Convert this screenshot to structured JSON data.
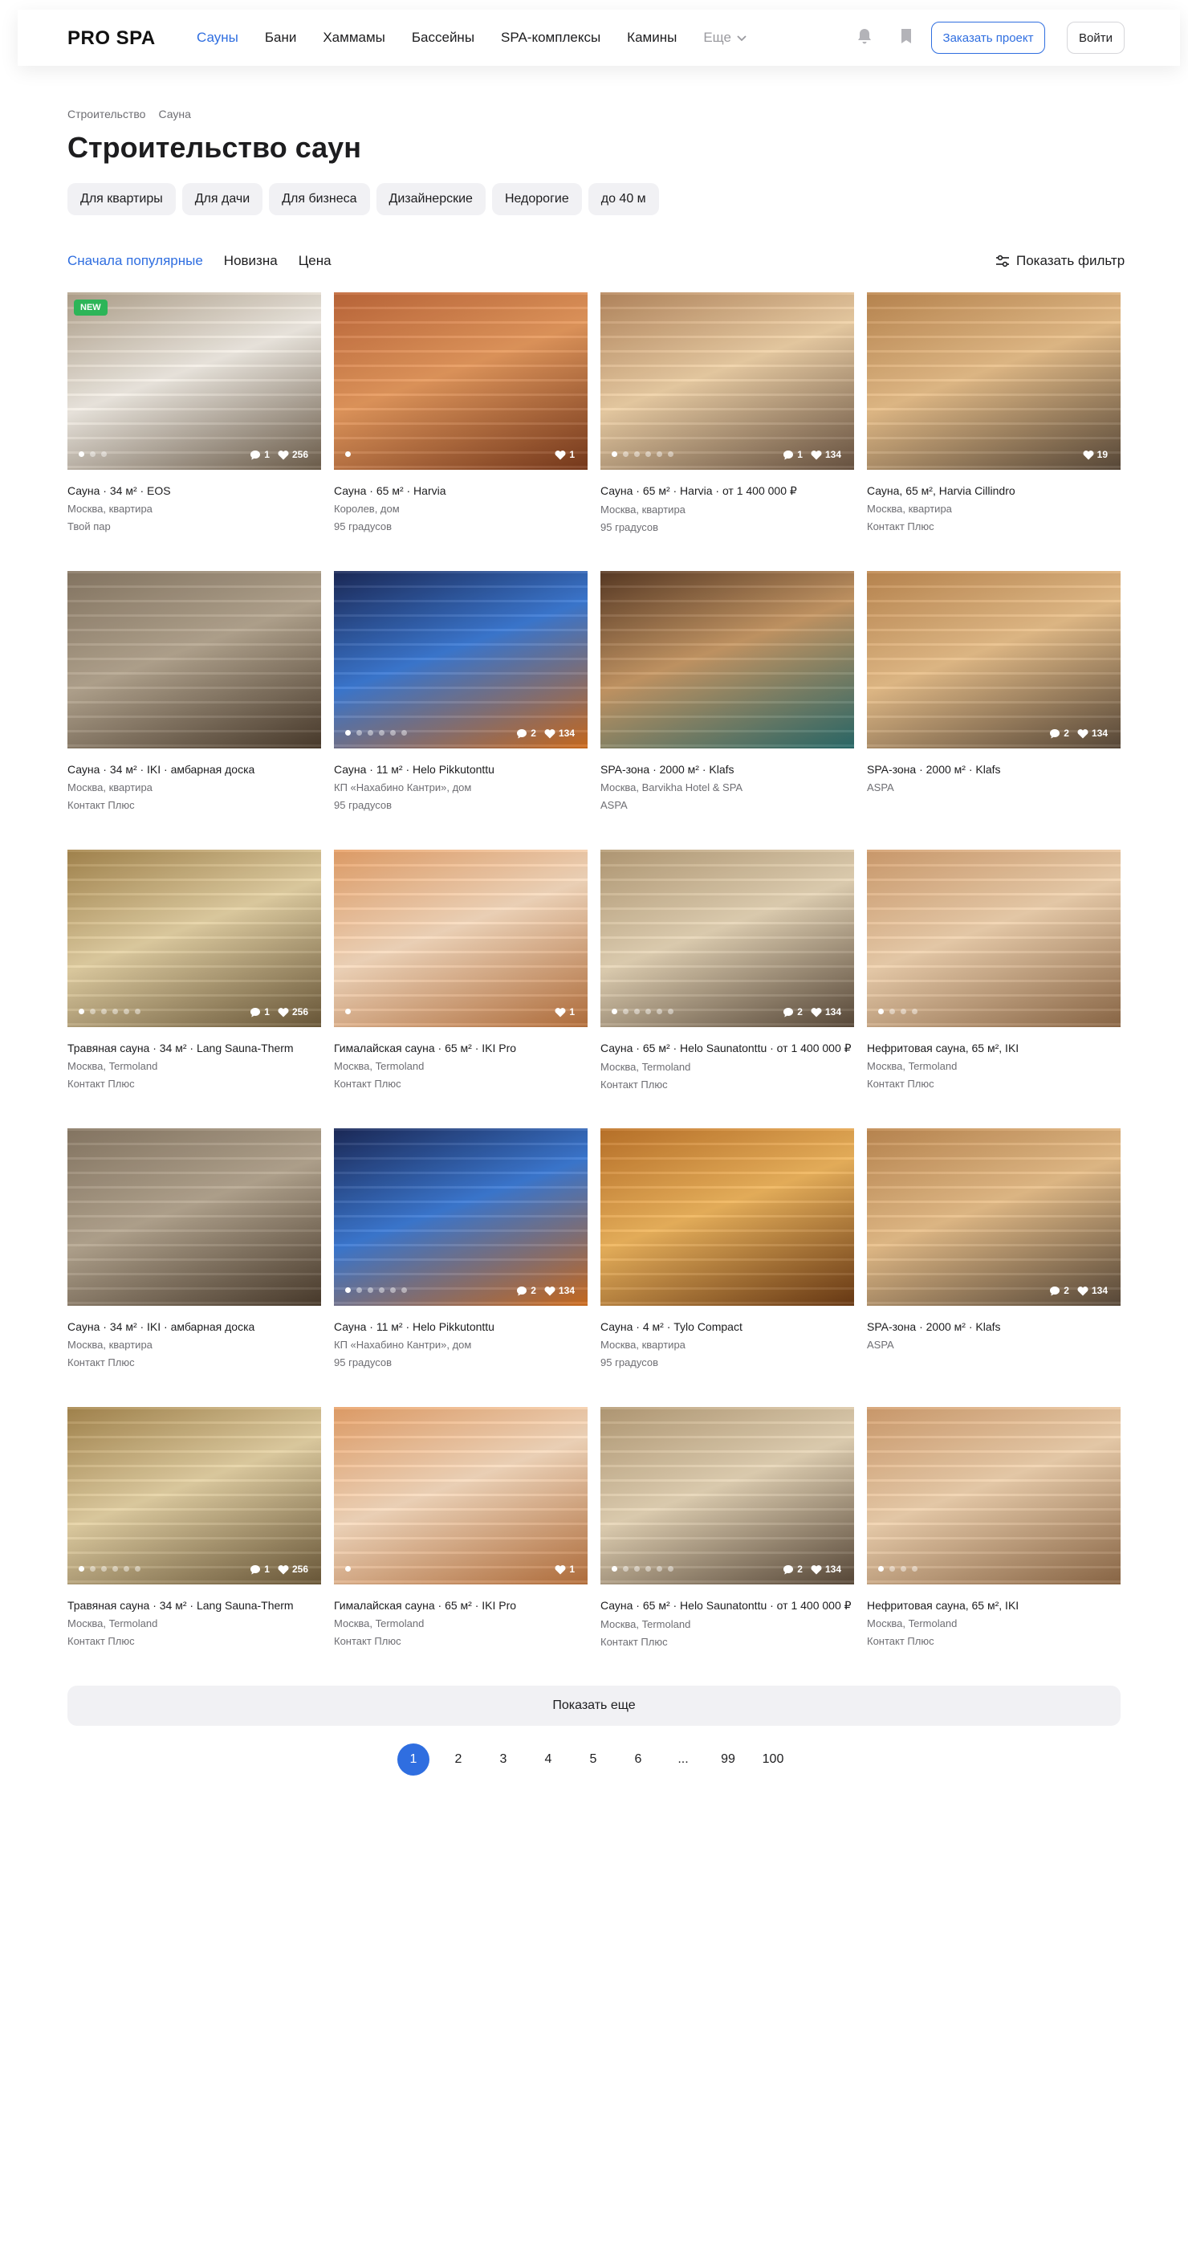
{
  "header": {
    "logo": "PRO SPA",
    "nav": [
      "Сауны",
      "Бани",
      "Хаммамы",
      "Бассейны",
      "SPA-комплексы",
      "Камины"
    ],
    "nav_active_index": 0,
    "more_label": "Еще",
    "order_button": "Заказать проект",
    "login_button": "Войти"
  },
  "breadcrumb": [
    "Строительство",
    "Сауна"
  ],
  "page_title": "Строительство саун",
  "chips": [
    "Для квартиры",
    "Для дачи",
    "Для бизнеса",
    "Дизайнерские",
    "Недорогие",
    "до 40 м"
  ],
  "sort": {
    "options": [
      "Сначала популярные",
      "Новизна",
      "Цена"
    ],
    "active_index": 0
  },
  "filter_label": "Показать фильтр",
  "colors": {
    "accent": "#2f6ee0",
    "new_badge": "#2db558"
  },
  "cards": [
    {
      "title": "Сауна · 34 м² · EOS",
      "location": "Москва, квартира",
      "company": "Твой пар",
      "badge": "NEW",
      "comments": "1",
      "likes": "256",
      "dots": 3,
      "palette": [
        "#b5a58f",
        "#f4efe7",
        "#6f5f4c"
      ]
    },
    {
      "title": "Сауна · 65 м² · Harvia",
      "location": "Королев, дом",
      "company": "95 градусов",
      "badge": "",
      "comments": "",
      "likes": "1",
      "dots": 1,
      "palette": [
        "#c2693b",
        "#e79a5e",
        "#7a3a1c"
      ]
    },
    {
      "title": "Сауна · 65 м² · Harvia · от 1 400 000 ₽",
      "location": "Москва, квартира",
      "company": "95 градусов",
      "badge": "",
      "comments": "1",
      "likes": "134",
      "dots": 6,
      "palette": [
        "#b98a60",
        "#f0d2a8",
        "#6a5442"
      ]
    },
    {
      "title": "Сауна, 65 м², Harvia Cillindro",
      "location": "Москва, квартира",
      "company": "Контакт Плюс",
      "badge": "",
      "comments": "",
      "likes": "19",
      "dots": 0,
      "palette": [
        "#c08a52",
        "#e9c08b",
        "#5a4a3a"
      ]
    },
    {
      "title": "Сауна · 34 м² · IKI · амбарная доска",
      "location": "Москва, квартира",
      "company": "Контакт Плюс",
      "badge": "",
      "comments": "",
      "likes": "",
      "dots": 0,
      "palette": [
        "#8a7a66",
        "#b7a892",
        "#4a3b2c"
      ]
    },
    {
      "title": "Сауна · 11 м² · Helo Pikkutonttu",
      "location": "КП «Нахабино Кантри», дом",
      "company": "95 градусов",
      "badge": "",
      "comments": "2",
      "likes": "134",
      "dots": 6,
      "palette": [
        "#1c2a5a",
        "#3d7bd6",
        "#d06d1e"
      ]
    },
    {
      "title": "SPA-зона · 2000 м² · Klafs",
      "location": "Москва, Barvikha Hotel & SPA",
      "company": "ASPA",
      "badge": "",
      "comments": "",
      "likes": "",
      "dots": 0,
      "palette": [
        "#5b3b25",
        "#c99a67",
        "#2a6b6b"
      ]
    },
    {
      "title": "SPA-зона · 2000 м² · Klafs",
      "location": "ASPA",
      "company": "",
      "badge": "",
      "comments": "2",
      "likes": "134",
      "dots": 0,
      "palette": [
        "#c08a52",
        "#e9c08b",
        "#5a4a3a"
      ]
    },
    {
      "title": "Травяная сауна · 34 м² · Lang Sauna-Therm",
      "location": "Москва, Termoland",
      "company": "Контакт Плюс",
      "badge": "",
      "comments": "1",
      "likes": "256",
      "dots": 6,
      "palette": [
        "#a8884f",
        "#e6d3a6",
        "#6d5a3a"
      ]
    },
    {
      "title": "Гималайская сауна · 65 м² · IKI Pro",
      "location": "Москва, Termoland",
      "company": "Контакт Плюс",
      "badge": "",
      "comments": "",
      "likes": "1",
      "dots": 1,
      "palette": [
        "#e9a36b",
        "#f8dcc0",
        "#b8723e"
      ]
    },
    {
      "title": "Сауна · 65 м² · Helo Saunatonttu · от 1 400 000 ₽",
      "location": "Москва, Termoland",
      "company": "Контакт Плюс",
      "badge": "",
      "comments": "2",
      "likes": "134",
      "dots": 6,
      "palette": [
        "#b89e78",
        "#e7d6b8",
        "#5a4a3a"
      ]
    },
    {
      "title": "Нефритовая сауна, 65 м², IKI",
      "location": "Москва, Termoland",
      "company": "Контакт Плюс",
      "badge": "",
      "comments": "",
      "likes": "",
      "dots": 4,
      "palette": [
        "#d4a070",
        "#f1d3b0",
        "#8f6a48"
      ]
    },
    {
      "title": "Сауна · 34 м² · IKI · амбарная доска",
      "location": "Москва, квартира",
      "company": "Контакт Плюс",
      "badge": "",
      "comments": "",
      "likes": "",
      "dots": 0,
      "palette": [
        "#8a7a66",
        "#b7a892",
        "#4a3b2c"
      ]
    },
    {
      "title": "Сауна · 11 м² · Helo Pikkutonttu",
      "location": "КП «Нахабино Кантри», дом",
      "company": "95 градусов",
      "badge": "",
      "comments": "2",
      "likes": "134",
      "dots": 6,
      "palette": [
        "#1c2a5a",
        "#3d7bd6",
        "#d06d1e"
      ]
    },
    {
      "title": "Сауна · 4 м² · Tylo Compact",
      "location": "Москва, квартира",
      "company": "95 градусов",
      "badge": "",
      "comments": "",
      "likes": "",
      "dots": 0,
      "palette": [
        "#c0752a",
        "#f0b65e",
        "#6b3a14"
      ]
    },
    {
      "title": "SPA-зона · 2000 м² · Klafs",
      "location": "ASPA",
      "company": "",
      "badge": "",
      "comments": "2",
      "likes": "134",
      "dots": 0,
      "palette": [
        "#c08a52",
        "#e9c08b",
        "#5a4a3a"
      ]
    },
    {
      "title": "Травяная сауна · 34 м² · Lang Sauna-Therm",
      "location": "Москва, Termoland",
      "company": "Контакт Плюс",
      "badge": "",
      "comments": "1",
      "likes": "256",
      "dots": 6,
      "palette": [
        "#a8884f",
        "#e6d3a6",
        "#6d5a3a"
      ]
    },
    {
      "title": "Гималайская сауна · 65 м² · IKI Pro",
      "location": "Москва, Termoland",
      "company": "Контакт Плюс",
      "badge": "",
      "comments": "",
      "likes": "1",
      "dots": 1,
      "palette": [
        "#e9a36b",
        "#f8dcc0",
        "#b8723e"
      ]
    },
    {
      "title": "Сауна · 65 м² · Helo Saunatonttu · от 1 400 000 ₽",
      "location": "Москва, Termoland",
      "company": "Контакт Плюс",
      "badge": "",
      "comments": "2",
      "likes": "134",
      "dots": 6,
      "palette": [
        "#b89e78",
        "#e7d6b8",
        "#5a4a3a"
      ]
    },
    {
      "title": "Нефритовая сауна, 65 м², IKI",
      "location": "Москва, Termoland",
      "company": "Контакт Плюс",
      "badge": "",
      "comments": "",
      "likes": "",
      "dots": 4,
      "palette": [
        "#d4a070",
        "#f1d3b0",
        "#8f6a48"
      ]
    }
  ],
  "more_button": "Показать еще",
  "pagination": [
    "1",
    "2",
    "3",
    "4",
    "5",
    "6",
    "...",
    "99",
    "100"
  ],
  "pagination_active_index": 0
}
